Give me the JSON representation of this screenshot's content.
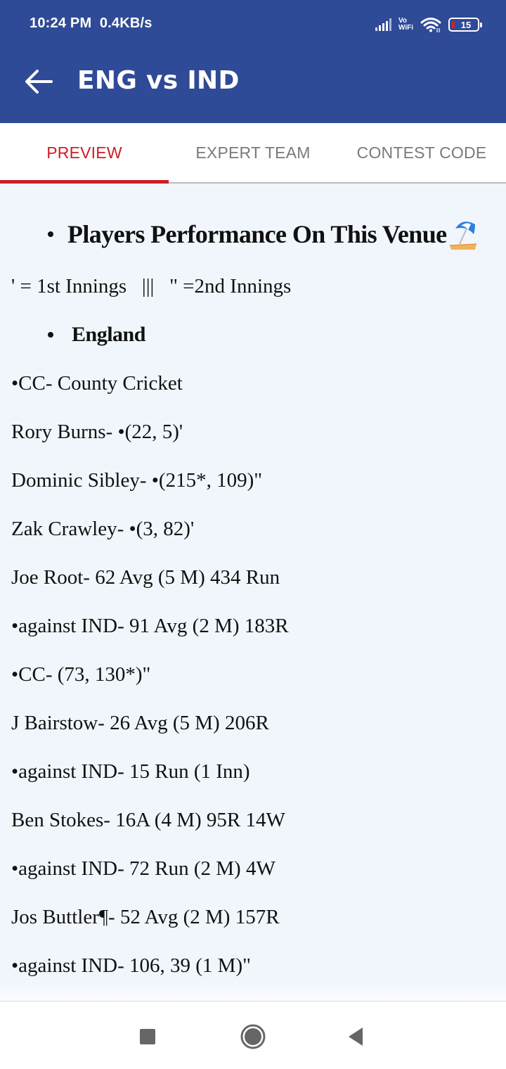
{
  "status_bar": {
    "time": "10:24 PM",
    "net_speed": "0.4KB/s",
    "vowifi_top": "Vo",
    "vowifi_bottom": "WiFi",
    "battery_level": "15",
    "icons": [
      "signal-icon",
      "vowifi-icon",
      "wifi-icon",
      "battery-icon"
    ]
  },
  "app_bar": {
    "title": "ENG vs IND",
    "back_icon": "arrow-left-icon"
  },
  "tabs": [
    {
      "label": "PREVIEW",
      "active": true
    },
    {
      "label": "EXPERT TEAM",
      "active": false
    },
    {
      "label": "CONTEST CODE",
      "active": false
    }
  ],
  "colors": {
    "primary": "#2f4a96",
    "accent": "#cc1f26",
    "tab_inactive": "#7a7a7a",
    "content_bg": "#f1f6fd"
  },
  "content": {
    "heading": "Players Performance On This Venue",
    "heading_emoji": "beach-umbrella-icon",
    "legend": "' = 1st Innings   |||   \" =2nd Innings",
    "team": "England",
    "lines": [
      "•CC- County Cricket",
      "Rory Burns- •(22, 5)'",
      "Dominic Sibley- •(215*, 109)\"",
      "Zak Crawley- •(3, 82)'",
      "Joe Root- 62 Avg (5 M) 434 Run",
      "•against IND- 91 Avg (2 M) 183R",
      "•CC- (73, 130*)\"",
      "J Bairstow- 26 Avg (5 M) 206R",
      "•against IND- 15 Run (1 Inn)",
      "Ben Stokes- 16A (4 M) 95R 14W",
      "•against IND- 72 Run (2 M) 4W",
      "Jos Buttler¶- 52 Avg (2 M) 157R",
      "•against IND- 106, 39 (1 M)\""
    ]
  },
  "nav_bar": {
    "buttons": [
      "recent-apps",
      "home",
      "back"
    ]
  }
}
